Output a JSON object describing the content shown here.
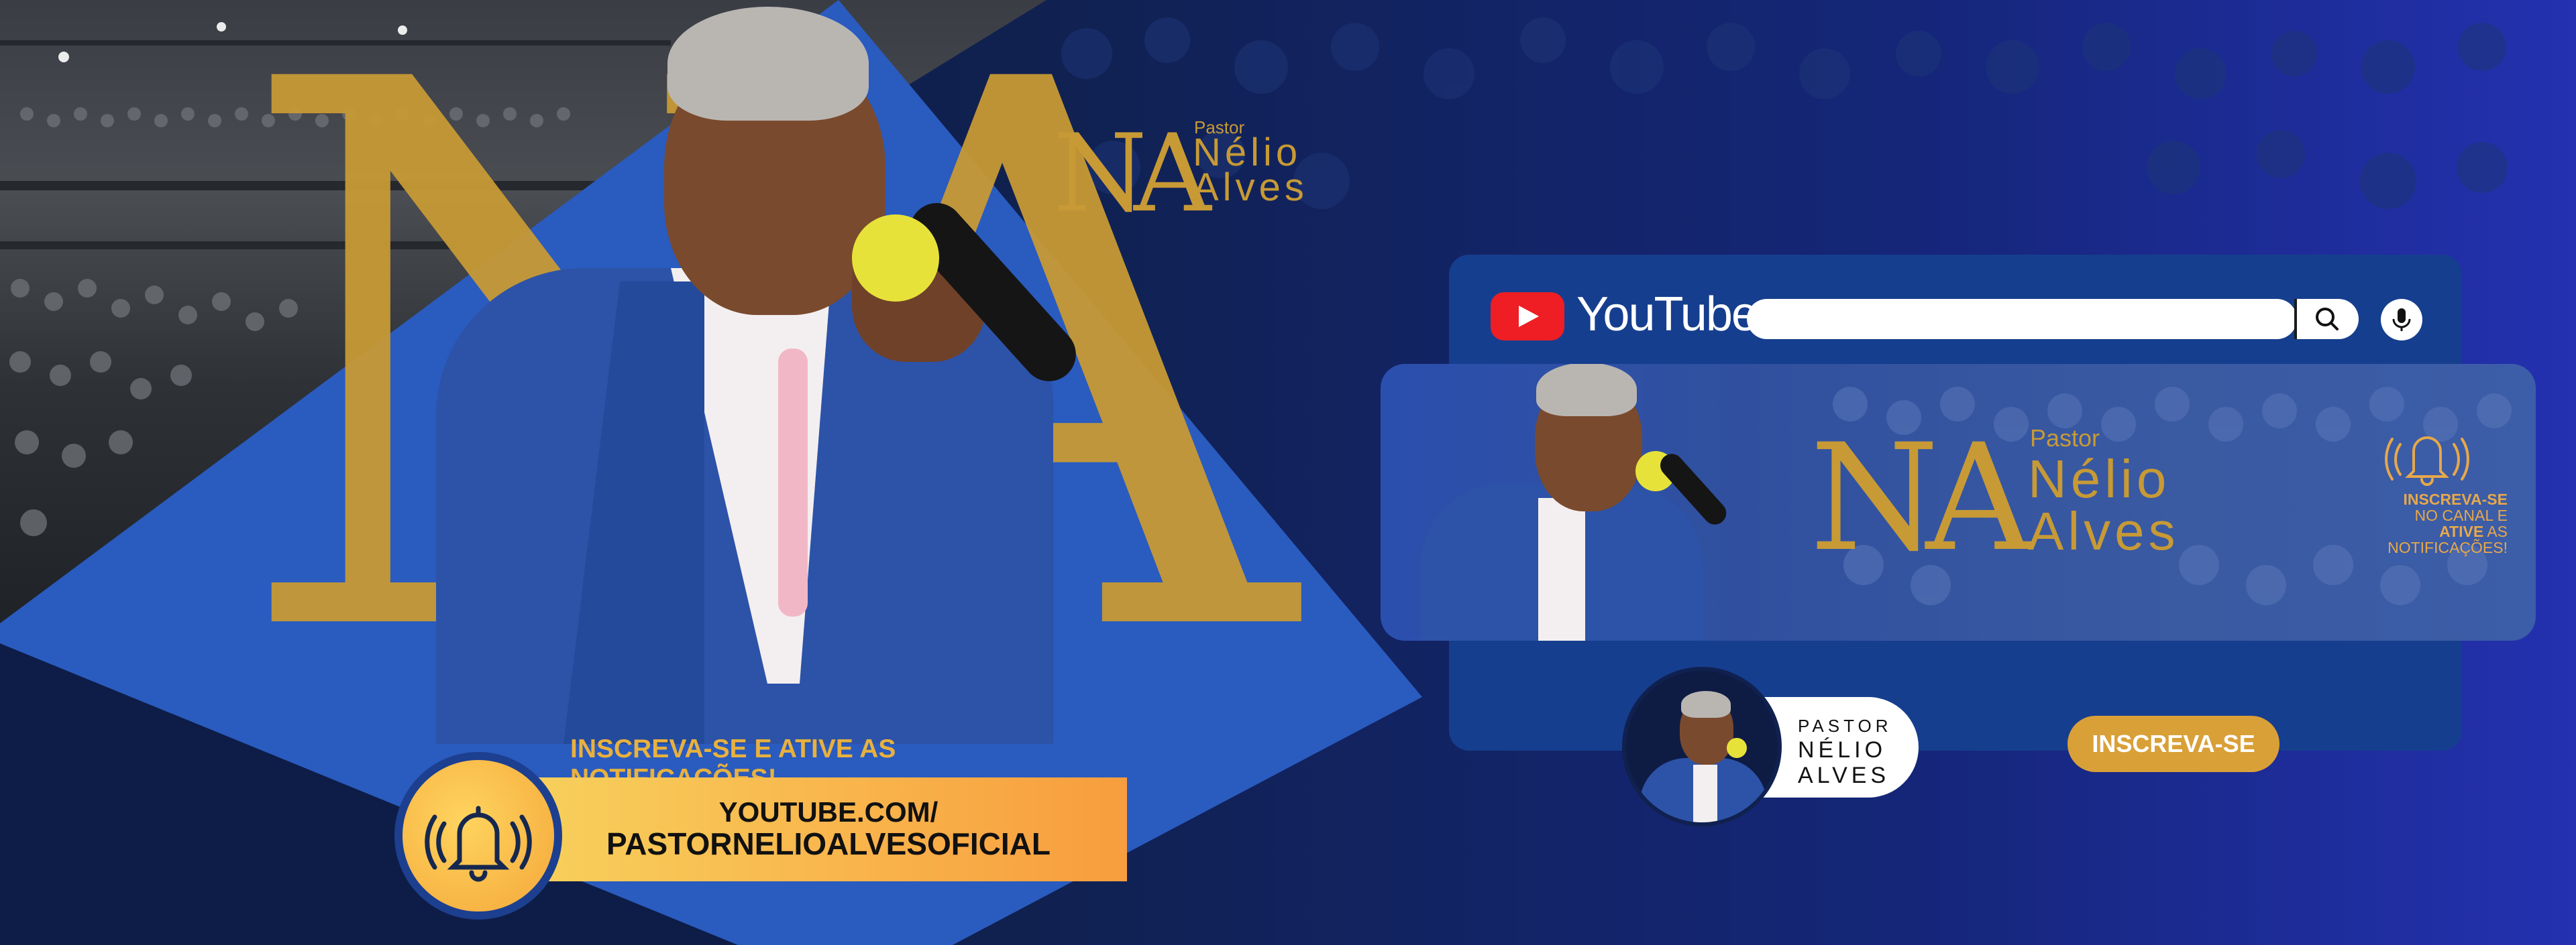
{
  "logo": {
    "monogram": "NA",
    "pastor": "Pastor",
    "first_name": "Nélio",
    "last_name": "Alves"
  },
  "cta": {
    "title": "INSCREVA-SE E ATIVE AS NOTIFICAÇÕES!",
    "url_line1": "YOUTUBE.COM/",
    "url_line2": "PASTORNELIOALVESOFICIAL"
  },
  "youtube": {
    "wordmark": "YouTube",
    "search_value": "",
    "banner_pastor": "Pastor",
    "banner_first_name": "Nélio",
    "banner_last_name": "Alves",
    "banner_monogram": "NA",
    "notif_line1": "INSCREVA-SE",
    "notif_line2": "NO CANAL E",
    "notif_line3_bold": "ATIVE",
    "notif_line3_rest": "AS",
    "notif_line4": "NOTIFICAÇÕES!",
    "channel_pastor": "PASTOR",
    "channel_first": "NÉLIO",
    "channel_last": "ALVES",
    "subscribe_label": "INSCREVA-SE"
  },
  "colors": {
    "gold": "#c79a35",
    "blue": "#2a5bbf",
    "navy": "#0e1d47",
    "youtube_red": "#ee1e24",
    "cta_orange": "#f9b44b"
  },
  "icons": [
    "bell-icon",
    "youtube-play-icon",
    "search-icon",
    "microphone-icon"
  ]
}
